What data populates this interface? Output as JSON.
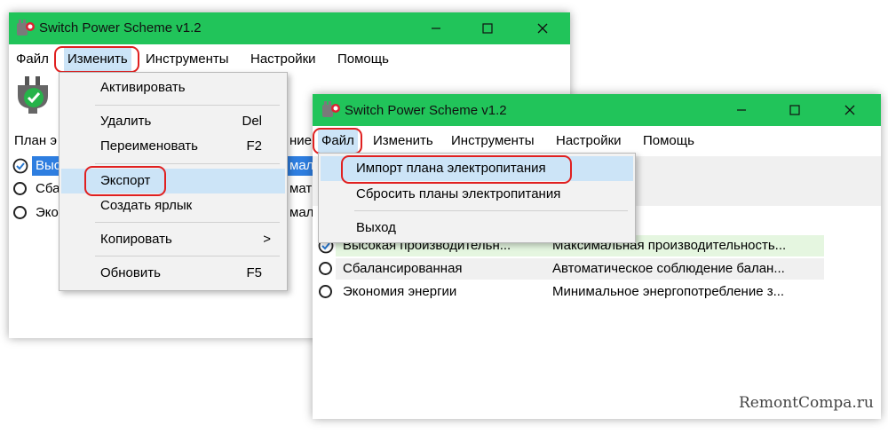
{
  "window_back": {
    "title": "Switch Power Scheme v1.2",
    "menu": [
      "Файл",
      "Изменить",
      "Инструменты",
      "Настройки",
      "Помощь"
    ],
    "column_header_left": "План э",
    "column_header_right": "ние",
    "rows": [
      {
        "name": "Выс",
        "desc": "мал"
      },
      {
        "name": "Сба",
        "desc": "мати"
      },
      {
        "name": "Эко",
        "desc": "мал"
      }
    ],
    "edit_menu": [
      {
        "label": "Активировать",
        "shortcut": ""
      },
      {
        "label": "Удалить",
        "shortcut": "Del"
      },
      {
        "label": "Переименовать",
        "shortcut": "F2"
      },
      {
        "label": "Экспорт",
        "shortcut": ""
      },
      {
        "label": "Создать ярлык",
        "shortcut": ""
      },
      {
        "label": "Копировать",
        "shortcut": "",
        "submenu_arrow": ">"
      },
      {
        "label": "Обновить",
        "shortcut": "F5"
      }
    ]
  },
  "window_front": {
    "title": "Switch Power Scheme v1.2",
    "menu": [
      "Файл",
      "Изменить",
      "Инструменты",
      "Настройки",
      "Помощь"
    ],
    "file_menu": [
      {
        "label": "Импорт плана электропитания"
      },
      {
        "label": "Сбросить планы электропитания"
      },
      {
        "label": "Выход"
      }
    ],
    "rows": [
      {
        "name": "Высокая производительн...",
        "desc": "Максимальная производительность...",
        "active": true
      },
      {
        "name": "Сбалансированная",
        "desc": "Автоматическое соблюдение балан...",
        "active": false
      },
      {
        "name": "Экономия энергии",
        "desc": "Минимальное энергопотребление з...",
        "active": false
      }
    ]
  },
  "colors": {
    "titlebar": "#21c45a",
    "highlight": "#cce4f7",
    "active_row": "#e5f6e0",
    "outline": "#e02020"
  },
  "watermark": "RemontCompa.ru"
}
